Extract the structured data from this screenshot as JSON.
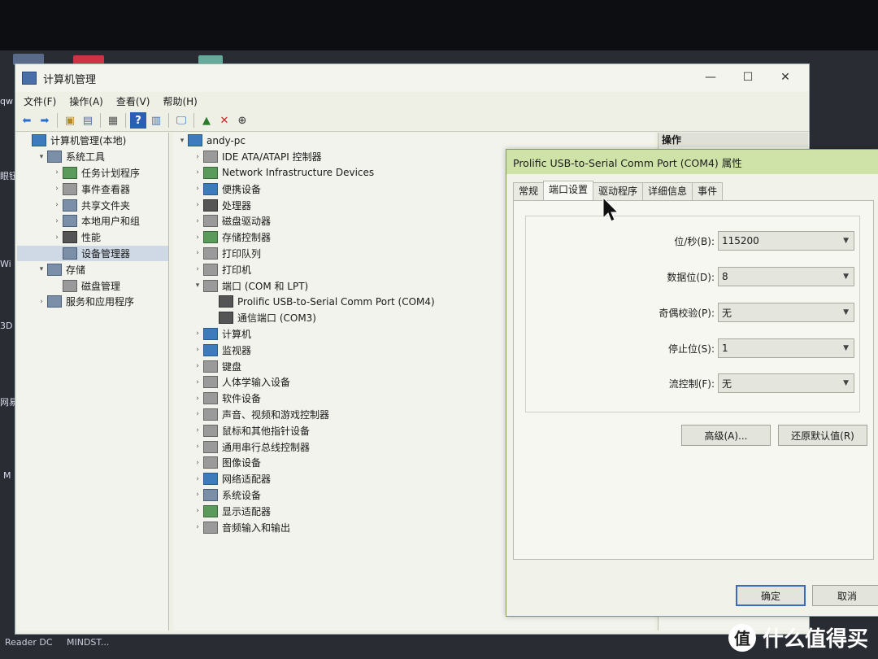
{
  "window": {
    "title": "计算机管理",
    "controls": [
      "—",
      "☐",
      "✕"
    ]
  },
  "menu": [
    "文件(F)",
    "操作(A)",
    "查看(V)",
    "帮助(H)"
  ],
  "left_tree": [
    {
      "label": "计算机管理(本地)",
      "indent": 0,
      "arrow": ""
    },
    {
      "label": "系统工具",
      "indent": 1,
      "arrow": "▾"
    },
    {
      "label": "任务计划程序",
      "indent": 2,
      "arrow": "›"
    },
    {
      "label": "事件查看器",
      "indent": 2,
      "arrow": "›"
    },
    {
      "label": "共享文件夹",
      "indent": 2,
      "arrow": "›"
    },
    {
      "label": "本地用户和组",
      "indent": 2,
      "arrow": "›"
    },
    {
      "label": "性能",
      "indent": 2,
      "arrow": "›"
    },
    {
      "label": "设备管理器",
      "indent": 2,
      "arrow": "",
      "selected": true
    },
    {
      "label": "存储",
      "indent": 1,
      "arrow": "▾"
    },
    {
      "label": "磁盘管理",
      "indent": 2,
      "arrow": ""
    },
    {
      "label": "服务和应用程序",
      "indent": 1,
      "arrow": "›"
    }
  ],
  "device_tree": [
    {
      "label": "andy-pc",
      "indent": 0,
      "arrow": "▾"
    },
    {
      "label": "IDE ATA/ATAPI 控制器",
      "indent": 1,
      "arrow": "›"
    },
    {
      "label": "Network Infrastructure Devices",
      "indent": 1,
      "arrow": "›"
    },
    {
      "label": "便携设备",
      "indent": 1,
      "arrow": "›"
    },
    {
      "label": "处理器",
      "indent": 1,
      "arrow": "›"
    },
    {
      "label": "磁盘驱动器",
      "indent": 1,
      "arrow": "›"
    },
    {
      "label": "存储控制器",
      "indent": 1,
      "arrow": "›"
    },
    {
      "label": "打印队列",
      "indent": 1,
      "arrow": "›"
    },
    {
      "label": "打印机",
      "indent": 1,
      "arrow": "›"
    },
    {
      "label": "端口 (COM 和 LPT)",
      "indent": 1,
      "arrow": "▾"
    },
    {
      "label": "Prolific USB-to-Serial Comm Port (COM4)",
      "indent": 2,
      "arrow": ""
    },
    {
      "label": "通信端口 (COM3)",
      "indent": 2,
      "arrow": ""
    },
    {
      "label": "计算机",
      "indent": 1,
      "arrow": "›"
    },
    {
      "label": "监视器",
      "indent": 1,
      "arrow": "›"
    },
    {
      "label": "键盘",
      "indent": 1,
      "arrow": "›"
    },
    {
      "label": "人体学输入设备",
      "indent": 1,
      "arrow": "›"
    },
    {
      "label": "软件设备",
      "indent": 1,
      "arrow": "›"
    },
    {
      "label": "声音、视频和游戏控制器",
      "indent": 1,
      "arrow": "›"
    },
    {
      "label": "鼠标和其他指针设备",
      "indent": 1,
      "arrow": "›"
    },
    {
      "label": "通用串行总线控制器",
      "indent": 1,
      "arrow": "›"
    },
    {
      "label": "图像设备",
      "indent": 1,
      "arrow": "›"
    },
    {
      "label": "网络适配器",
      "indent": 1,
      "arrow": "›"
    },
    {
      "label": "系统设备",
      "indent": 1,
      "arrow": "›"
    },
    {
      "label": "显示适配器",
      "indent": 1,
      "arrow": "›"
    },
    {
      "label": "音频输入和输出",
      "indent": 1,
      "arrow": "›"
    }
  ],
  "actions_header": "操作",
  "dialog": {
    "title": "Prolific USB-to-Serial Comm Port (COM4) 属性",
    "tabs": [
      "常规",
      "端口设置",
      "驱动程序",
      "详细信息",
      "事件"
    ],
    "active_tab": 1,
    "fields": [
      {
        "label": "位/秒(B):",
        "value": "115200"
      },
      {
        "label": "数据位(D):",
        "value": "8"
      },
      {
        "label": "奇偶校验(P):",
        "value": "无"
      },
      {
        "label": "停止位(S):",
        "value": "1"
      },
      {
        "label": "流控制(F):",
        "value": "无"
      }
    ],
    "advanced_button": "高级(A)...",
    "restore_button": "还原默认值(R)",
    "ok_button": "确定",
    "cancel_button": "取消"
  },
  "desktop": {
    "left_labels": [
      "qw",
      "眼钮",
      "Wi",
      "3D",
      "网易",
      "M"
    ],
    "taskbar": [
      "Reader DC",
      "MINDST..."
    ]
  },
  "watermark": {
    "glyph": "值",
    "text": "什么值得买"
  }
}
